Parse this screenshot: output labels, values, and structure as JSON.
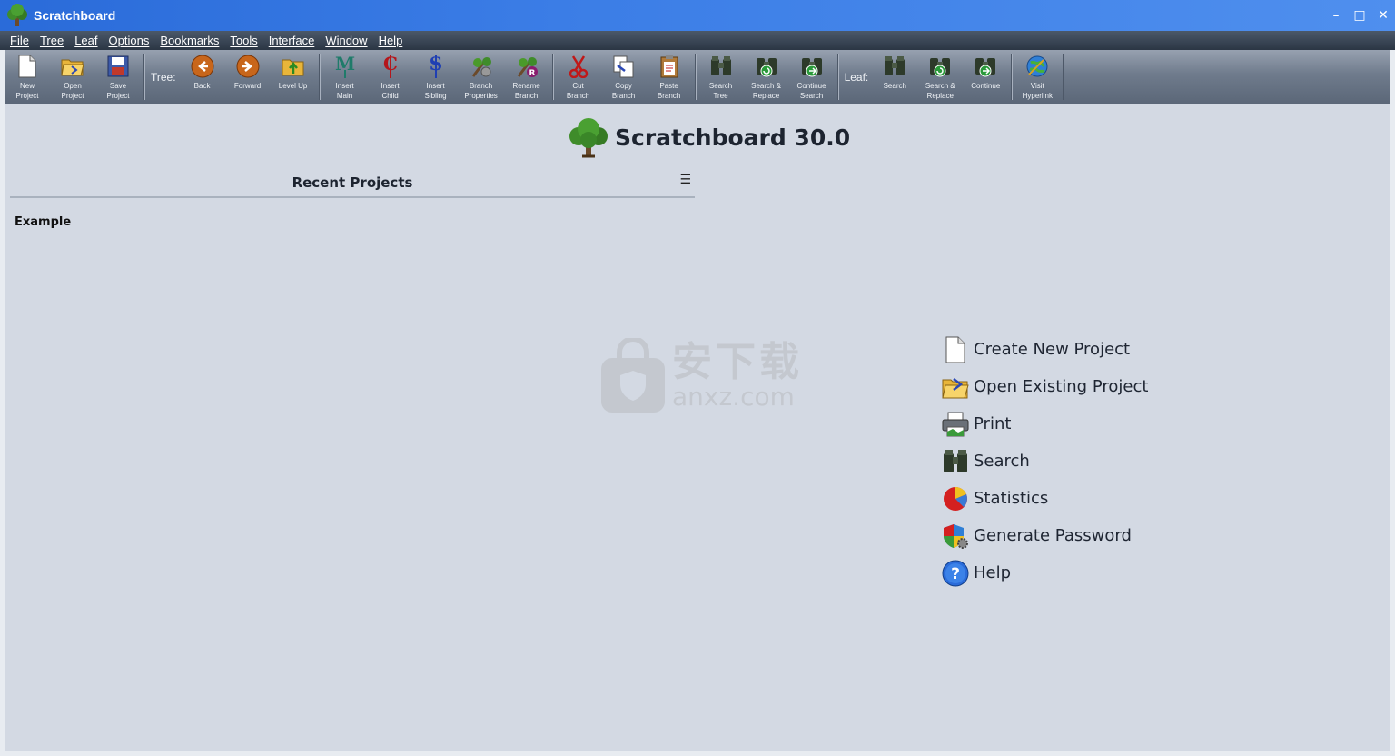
{
  "window": {
    "title": "Scratchboard",
    "controls": [
      "–",
      "□",
      "✕"
    ]
  },
  "menu": [
    "File",
    "Tree",
    "Leaf",
    "Options",
    "Bookmarks",
    "Tools",
    "Interface",
    "Window",
    "Help"
  ],
  "toolbar": {
    "project": [
      {
        "label": "New\nProject",
        "icon": "new-page-icon"
      },
      {
        "label": "Open\nProject",
        "icon": "open-folder-icon"
      },
      {
        "label": "Save\nProject",
        "icon": "floppy-icon"
      }
    ],
    "tree_label": "Tree:",
    "navigation": [
      {
        "label": "Back",
        "icon": "back-arrow-icon"
      },
      {
        "label": "Forward",
        "icon": "forward-arrow-icon"
      },
      {
        "label": "Level Up",
        "icon": "level-up-icon"
      }
    ],
    "insert": [
      {
        "label": "Insert\nMain",
        "icon": "insert-main-icon",
        "letter": "M",
        "color": "#1f7b6a"
      },
      {
        "label": "Insert\nChild",
        "icon": "insert-child-icon",
        "letter": "C",
        "color": "#b5161b"
      },
      {
        "label": "Insert\nSibling",
        "icon": "insert-sibling-icon",
        "letter": "S",
        "color": "#1f3fb3"
      },
      {
        "label": "Branch\nProperties",
        "icon": "branch-properties-icon"
      },
      {
        "label": "Rename\nBranch",
        "icon": "rename-branch-icon"
      }
    ],
    "clipboard": [
      {
        "label": "Cut\nBranch",
        "icon": "scissors-icon"
      },
      {
        "label": "Copy\nBranch",
        "icon": "copy-icon"
      },
      {
        "label": "Paste\nBranch",
        "icon": "paste-icon"
      }
    ],
    "tree_search": [
      {
        "label": "Search\nTree",
        "icon": "binoculars-icon"
      },
      {
        "label": "Search &\nReplace",
        "icon": "binoculars-replace-icon"
      },
      {
        "label": "Continue\nSearch",
        "icon": "binoculars-continue-icon"
      }
    ],
    "leaf_label": "Leaf:",
    "leaf_search": [
      {
        "label": "Search",
        "icon": "binoculars-icon"
      },
      {
        "label": "Search &\nReplace",
        "icon": "binoculars-replace-icon"
      },
      {
        "label": "Continue",
        "icon": "binoculars-continue-icon"
      }
    ],
    "web": [
      {
        "label": "Visit\nHyperlink",
        "icon": "globe-icon"
      }
    ]
  },
  "main": {
    "heading": "Scratchboard 30.0",
    "recent_title": "Recent Projects",
    "recent_menu_glyph": "☰",
    "recent_projects": [
      "Example"
    ],
    "actions": [
      {
        "label": "Create New Project",
        "icon": "new-page-icon"
      },
      {
        "label": "Open Existing Project",
        "icon": "open-folder-icon"
      },
      {
        "label": "Print",
        "icon": "printer-icon"
      },
      {
        "label": "Search",
        "icon": "binoculars-icon"
      },
      {
        "label": "Statistics",
        "icon": "pie-chart-icon"
      },
      {
        "label": "Generate Password",
        "icon": "shield-gear-icon"
      },
      {
        "label": "Help",
        "icon": "help-icon"
      }
    ]
  },
  "watermark": {
    "cn": "安下载",
    "en": "anxz.com"
  },
  "colors": {
    "titlebar": "#3b7de6",
    "menubar": "#2b3644",
    "toolbar": "#6f7b8c",
    "workspace": "#d3d9e3"
  }
}
